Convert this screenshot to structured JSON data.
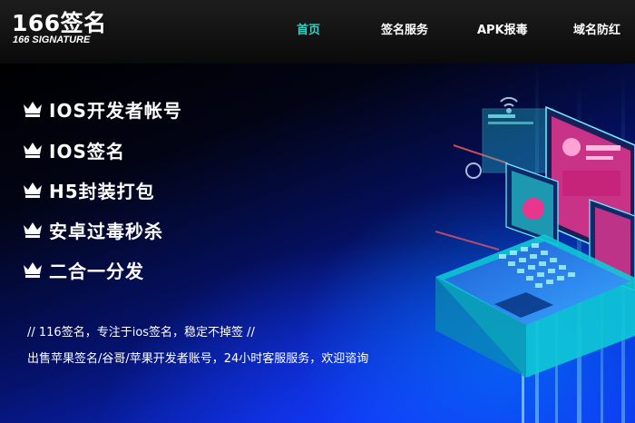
{
  "header": {
    "logo": "166签名",
    "logo_sub": "166 SIGNATURE",
    "nav": [
      {
        "label": "首页",
        "active": true
      },
      {
        "label": "签名服务",
        "active": false
      },
      {
        "label": "APK报毒",
        "active": false
      },
      {
        "label": "域名防红",
        "active": false
      }
    ]
  },
  "hero": {
    "features": [
      {
        "label": "IOS开发者帐号",
        "icon": "crown-icon"
      },
      {
        "label": "IOS签名",
        "icon": "crown-icon"
      },
      {
        "label": "H5封装打包",
        "icon": "crown-icon"
      },
      {
        "label": "安卓过毒秒杀",
        "icon": "crown-icon"
      },
      {
        "label": "二合一分发",
        "icon": "crown-icon"
      }
    ],
    "tagline_1": "// 116签名，专注于ios签名，稳定不掉签 //",
    "tagline_2": "出售苹果签名/谷哥/苹果开发者账号，24小时客服服务，欢迎谘询"
  },
  "colors": {
    "active_nav": "#2ed3c6",
    "hero_blue": "#0b2bdc",
    "illustration_accent": "#ff3d9a"
  }
}
